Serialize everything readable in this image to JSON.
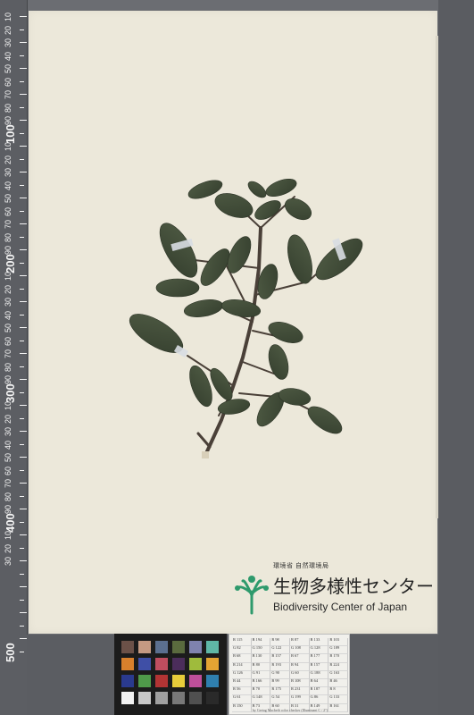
{
  "scale_ruler": {
    "major_labels": [
      "100",
      "200",
      "300",
      "400",
      "500"
    ],
    "minor_labels": [
      "10",
      "20",
      "30",
      "40",
      "50",
      "60",
      "70",
      "80",
      "90",
      "10",
      "20",
      "30",
      "40",
      "50",
      "60",
      "70",
      "80",
      "90",
      "10",
      "20",
      "30",
      "40",
      "50",
      "60",
      "70",
      "80",
      "90",
      "10",
      "20",
      "30",
      "40",
      "50",
      "60",
      "70",
      "80",
      "90",
      "10",
      "20",
      "30"
    ]
  },
  "institution": {
    "ministry": "環境省 自然環境局",
    "name_jp": "生物多様性センター",
    "name_en": "Biodiversity Center of Japan",
    "logo_color": "#2e9a6c"
  },
  "color_card": {
    "swatches": [
      "#6b5148",
      "#c59a82",
      "#5b6f8f",
      "#5a6a3e",
      "#7f82ae",
      "#5fb7a6",
      "#d8802c",
      "#3f4fa6",
      "#c04d5f",
      "#4b2d5b",
      "#9fbb3c",
      "#e3a433",
      "#2a3a8e",
      "#4f9a4a",
      "#b23434",
      "#e7cc3a",
      "#bf4f9a",
      "#2f7fae",
      "#f2f2f2",
      "#c8c8c8",
      "#a0a0a0",
      "#787878",
      "#505050",
      "#2a2a2a"
    ]
  },
  "value_card": {
    "rows": [
      [
        "R 115",
        "R 194",
        "R 98",
        "R 87",
        "R 133",
        "R 103"
      ],
      [
        "G 82",
        "G 150",
        "G 122",
        "G 108",
        "G 128",
        "G 189"
      ],
      [
        "B 68",
        "B 130",
        "B 157",
        "B 67",
        "B 177",
        "B 170"
      ],
      [
        "R 214",
        "R 80",
        "R 193",
        "R 94",
        "R 157",
        "R 224"
      ],
      [
        "G 126",
        "G 91",
        "G 90",
        "G 60",
        "G 188",
        "G 163"
      ],
      [
        "B 44",
        "B 166",
        "B 99",
        "B 108",
        "B 64",
        "B 46"
      ],
      [
        "R 56",
        "R 70",
        "R 175",
        "R 231",
        "R 187",
        "R 8"
      ],
      [
        "G 61",
        "G 148",
        "G 54",
        "G 199",
        "G 86",
        "G 133"
      ],
      [
        "B 150",
        "B 73",
        "B 60",
        "B 31",
        "B 149",
        "B 161"
      ]
    ],
    "caption": "by Gretag Macbeth color checker (Illuminant C / 2°)"
  }
}
